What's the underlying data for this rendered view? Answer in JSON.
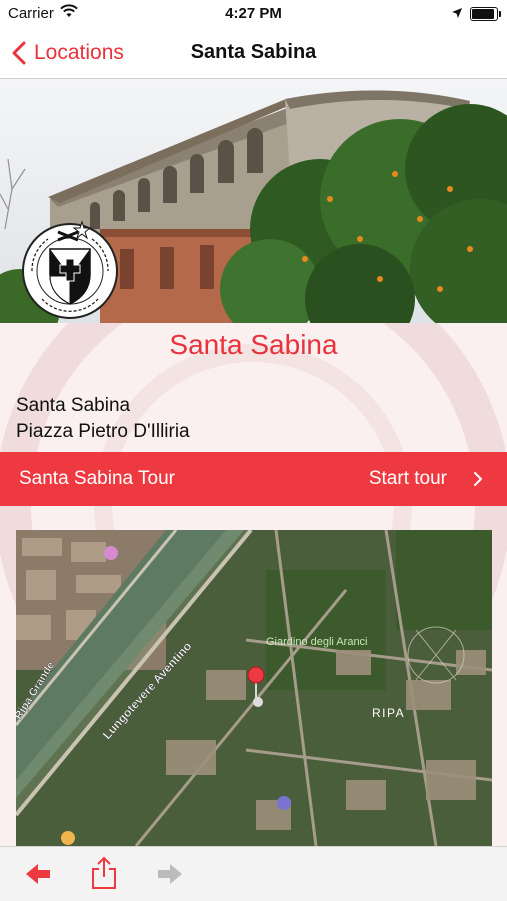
{
  "status_bar": {
    "carrier": "Carrier",
    "time": "4:27 PM",
    "battery_level": 1.0
  },
  "nav": {
    "back_label": "Locations",
    "title": "Santa Sabina"
  },
  "hero": {
    "crest_text": "LAUDARE BENEDICERE PRAEDICARE"
  },
  "location": {
    "title": "Santa Sabina",
    "address_line1": "Santa Sabina",
    "address_line2": "Piazza Pietro D'Illiria"
  },
  "tour": {
    "name": "Santa Sabina Tour",
    "action": "Start tour"
  },
  "map": {
    "labels": {
      "street_1": "Lungotevere Aventino",
      "street_2": "Ripa Grande",
      "park": "Giardino degli Aranci",
      "district": "RIPA"
    }
  },
  "toolbar": {
    "icons": [
      "back-arrow-icon",
      "share-icon",
      "forward-arrow-icon"
    ]
  },
  "colors": {
    "accent": "#e8323c",
    "tour_bar": "#ee3940",
    "content_bg": "#fbf0f0"
  }
}
